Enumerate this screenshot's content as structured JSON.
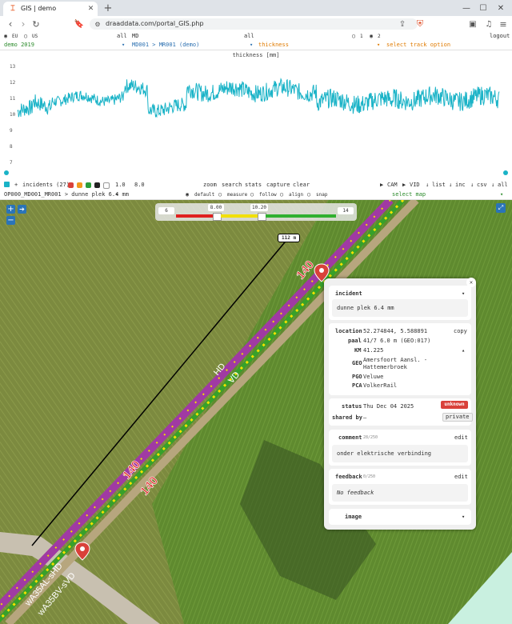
{
  "browser": {
    "tab_title": "GIS | demo",
    "url": "draaddata.com/portal_GIS.php"
  },
  "filters": {
    "region_eu": "EU",
    "region_us": "US",
    "all_1": "all",
    "md": "MD",
    "all_2": "all",
    "opt_1": "1",
    "opt_2": "2",
    "logout": "logout"
  },
  "selectors": {
    "project": "demo 2019",
    "track": "MD001 > MR001 (demo)",
    "metric": "thickness",
    "track_option": "select track option"
  },
  "chart_data": {
    "type": "line",
    "title": "thickness [mm]",
    "y_ticks": [
      "13",
      "12",
      "11",
      "10",
      "9",
      "8",
      "7"
    ],
    "ylim": [
      6.5,
      13.5
    ],
    "color": "#1ab3c7",
    "segments": [
      {
        "x": [
          0,
          0.03
        ],
        "base": 10.2,
        "noise": 0.5
      },
      {
        "x": [
          0.03,
          0.07
        ],
        "base": 10.6,
        "noise": 0.5
      },
      {
        "x": [
          0.07,
          0.22
        ],
        "base": 11.0,
        "noise": 0.35
      },
      {
        "x": [
          0.22,
          0.27
        ],
        "base": 11.6,
        "noise": 0.45
      },
      {
        "x": [
          0.27,
          0.35
        ],
        "base": 10.4,
        "noise": 0.45
      },
      {
        "x": [
          0.35,
          0.62
        ],
        "base": 11.5,
        "noise": 0.55
      },
      {
        "x": [
          0.62,
          0.78
        ],
        "base": 10.8,
        "noise": 0.6
      },
      {
        "x": [
          0.78,
          1.0
        ],
        "base": 11.0,
        "noise": 0.6
      }
    ]
  },
  "toolbar": {
    "plus": "+",
    "incidents": "incidents (27)",
    "swatch_colors": [
      "#d9413a",
      "#f29a1d",
      "#2c9e3a",
      "#222222",
      "#ffffff"
    ],
    "min_val": "1.0",
    "max_val": "8.0",
    "zoom": "zoom",
    "search": "search",
    "stats": "stats",
    "capture": "capture",
    "clear": "clear",
    "cam": "CAM",
    "vid": "VID",
    "list": "list",
    "inc": "inc",
    "csv": "csv",
    "all": "all"
  },
  "incident_bar": {
    "incident_select": "OP000_MD001_MR001 > dunne plek 6.4 mm",
    "mode_default": "default",
    "mode_measure": "measure",
    "mode_follow": "follow",
    "mode_align": "align",
    "mode_snap": "snap",
    "map_select": "select map"
  },
  "map": {
    "legend": {
      "v0": "6",
      "v1": "8.00",
      "v2": "10.20",
      "v3": "14"
    },
    "scale_label": "112 m",
    "speed_labels": [
      "140",
      "140",
      "140"
    ],
    "track_labels": [
      "HD",
      "VD",
      "wA35AL-sHD",
      "wA35BV-sVD"
    ]
  },
  "popup": {
    "incident_header": "incident",
    "incident_text": "dunne plek 6.4 mm",
    "location_label": "location",
    "location_value": "52.274844, 5.588891",
    "copy": "copy",
    "paal_label": "paal",
    "paal_value": "41/7 6.0 m (GEO:017)",
    "km_label": "KM",
    "km_value": "41.225",
    "geo_label": "GEO",
    "geo_value": "Amersfoort Aansl. - Hattemerbroek",
    "pgo_label": "PGO",
    "pgo_value": "Veluwe",
    "pca_label": "PCA",
    "pca_value": "VolkerRail",
    "status_label": "status",
    "status_date": "Thu Dec 04 2025",
    "status_badge": "unknown",
    "shared_label": "shared by",
    "shared_value": "—",
    "private": "private",
    "comment_label": "comment",
    "comment_count": "28/250",
    "comment_edit": "edit",
    "comment_text": "onder elektrische verbinding",
    "feedback_label": "feedback",
    "feedback_count": "0/250",
    "feedback_edit": "edit",
    "feedback_text": "No feedback",
    "image_label": "image"
  }
}
